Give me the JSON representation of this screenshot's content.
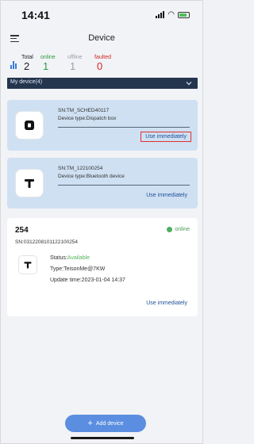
{
  "status_bar": {
    "time": "14:41"
  },
  "header": {
    "title": "Device"
  },
  "stats": {
    "total": {
      "label": "Total",
      "value": "2",
      "color": "#222222"
    },
    "online": {
      "label": "online",
      "value": "1",
      "color": "#2e9a44"
    },
    "offline": {
      "label": "offline",
      "value": "1",
      "color": "#9aa0a8"
    },
    "faulted": {
      "label": "faulted",
      "value": "0",
      "color": "#d42626"
    }
  },
  "my_device": {
    "label": "My device(4)"
  },
  "devices": [
    {
      "sn": "SN:TM_SCHED40117",
      "type": "Device type:Dispatch box",
      "action": "Use immediately"
    },
    {
      "sn": "SN:TM_122100254",
      "type": "Device type:Bluetooth device",
      "action": "Use immediately"
    }
  ],
  "detail": {
    "name": "254",
    "status_badge": "online",
    "sn": "SN:0312208101122100254",
    "status_label": "Status:",
    "status_value": "Available",
    "type": "Type:TeisonMe@7KW",
    "update_time": "Update time:2023-01-04 14:37",
    "action": "Use immediately"
  },
  "add_button": {
    "label": "Add device",
    "icon": "plus-icon"
  },
  "colors": {
    "accent": "#5b8ee0",
    "card_bg": "#cfe0f2",
    "bar_bg": "#24354e",
    "highlight": "#e23030"
  }
}
